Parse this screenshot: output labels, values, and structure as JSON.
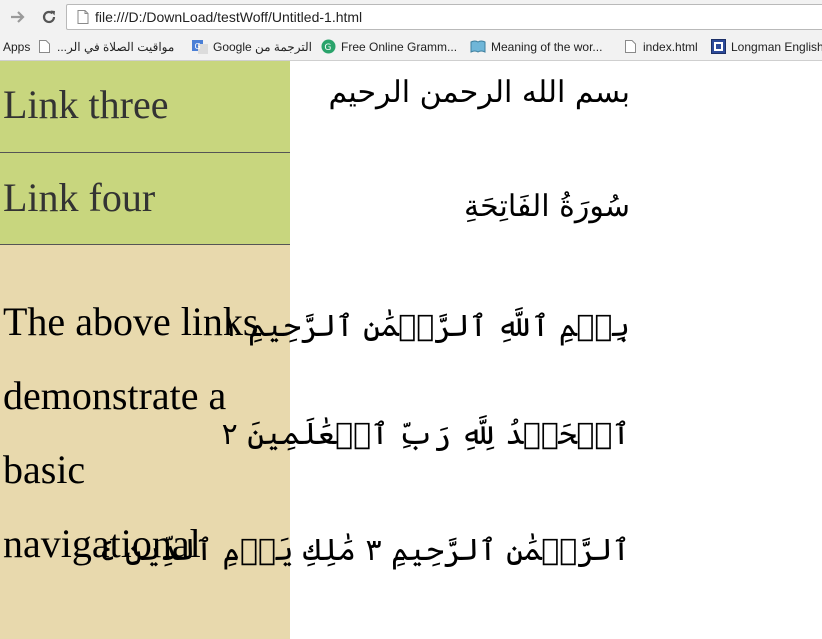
{
  "browser": {
    "url": "file:///D:/DownLoad/testWoff/Untitled-1.html",
    "bookmarks": [
      {
        "label": "Apps",
        "icon": "apps-icon"
      },
      {
        "label": "مواقيت الصلاة في الر...",
        "icon": "page-icon"
      },
      {
        "label": "الترجمة من Google",
        "icon": "google-translate-icon"
      },
      {
        "label": "Free Online Gramm...",
        "icon": "grammarly-icon"
      },
      {
        "label": "Meaning of the wor...",
        "icon": "book-icon"
      },
      {
        "label": "index.html",
        "icon": "page-icon"
      },
      {
        "label": "Longman English",
        "icon": "longman-icon"
      }
    ]
  },
  "sidebar": {
    "links": [
      "Link three",
      "Link four"
    ],
    "note": "The above links demonstrate a basic navigational"
  },
  "content": {
    "lines": [
      "بسم الله الرحمن الرحيم",
      "سُورَةُ الفَاتِحَةِ",
      "بِسۡمِ ٱللَّهِ ٱلرَّحۡمَٰنِ ٱلرَّحِيمِ ١",
      "ٱلۡحَمۡدُ لِلَّهِ رَبِّ ٱلۡعَٰلَمِينَ ٢",
      "ٱلرَّحۡمَٰنِ ٱلرَّحِيمِ ٣ مَٰلِكِ يَوۡمِ ٱلدِّينِ ٤"
    ]
  },
  "colors": {
    "link_bg": "#c8d67e",
    "note_bg": "#e8d9ad",
    "chrome_bg": "#f2f2f2"
  }
}
